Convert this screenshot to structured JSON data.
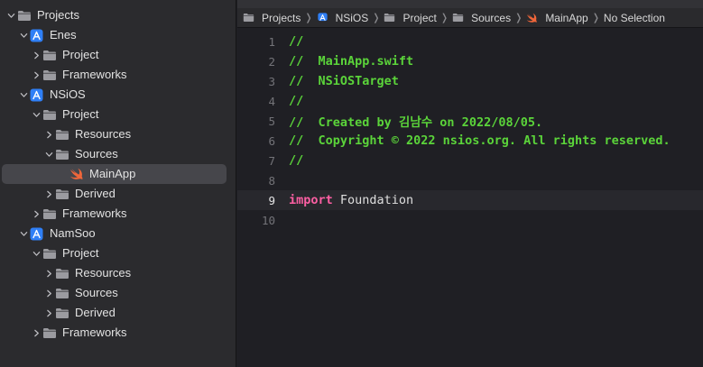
{
  "navigator": {
    "items": [
      {
        "label": "Projects",
        "icon": "folder-icon",
        "depth": 0,
        "expanded": true
      },
      {
        "label": "Enes",
        "icon": "app-target-icon",
        "depth": 1,
        "expanded": true
      },
      {
        "label": "Project",
        "icon": "folder-icon",
        "depth": 2,
        "expanded": false
      },
      {
        "label": "Frameworks",
        "icon": "folder-icon",
        "depth": 2,
        "expanded": false
      },
      {
        "label": "NSiOS",
        "icon": "app-target-icon",
        "depth": 1,
        "expanded": true
      },
      {
        "label": "Project",
        "icon": "folder-icon",
        "depth": 2,
        "expanded": true
      },
      {
        "label": "Resources",
        "icon": "folder-icon",
        "depth": 3,
        "expanded": false
      },
      {
        "label": "Sources",
        "icon": "folder-icon",
        "depth": 3,
        "expanded": true
      },
      {
        "label": "MainApp",
        "icon": "swift-file-icon",
        "depth": 4,
        "selected": true
      },
      {
        "label": "Derived",
        "icon": "folder-icon",
        "depth": 3,
        "expanded": false
      },
      {
        "label": "Frameworks",
        "icon": "folder-icon",
        "depth": 2,
        "expanded": false
      },
      {
        "label": "NamSoo",
        "icon": "app-target-icon",
        "depth": 1,
        "expanded": true
      },
      {
        "label": "Project",
        "icon": "folder-icon",
        "depth": 2,
        "expanded": true
      },
      {
        "label": "Resources",
        "icon": "folder-icon",
        "depth": 3,
        "expanded": false
      },
      {
        "label": "Sources",
        "icon": "folder-icon",
        "depth": 3,
        "expanded": false
      },
      {
        "label": "Derived",
        "icon": "folder-icon",
        "depth": 3,
        "expanded": false
      },
      {
        "label": "Frameworks",
        "icon": "folder-icon",
        "depth": 2,
        "expanded": false
      }
    ]
  },
  "jumpbar": {
    "crumbs": [
      {
        "label": "Projects",
        "icon": "folder-icon"
      },
      {
        "label": "NSiOS",
        "icon": "app-target-icon"
      },
      {
        "label": "Project",
        "icon": "folder-icon"
      },
      {
        "label": "Sources",
        "icon": "folder-icon"
      },
      {
        "label": "MainApp",
        "icon": "swift-file-icon"
      },
      {
        "label": "No Selection",
        "icon": ""
      }
    ]
  },
  "editor": {
    "current_line": 9,
    "lines": [
      {
        "num": "1",
        "segments": [
          {
            "text": "//",
            "kind": "comment"
          }
        ]
      },
      {
        "num": "2",
        "segments": [
          {
            "text": "//  MainApp.swift",
            "kind": "comment"
          }
        ]
      },
      {
        "num": "3",
        "segments": [
          {
            "text": "//  NSiOSTarget",
            "kind": "comment"
          }
        ]
      },
      {
        "num": "4",
        "segments": [
          {
            "text": "//",
            "kind": "comment"
          }
        ]
      },
      {
        "num": "5",
        "segments": [
          {
            "text": "//  Created by 김남수 on 2022/08/05.",
            "kind": "comment"
          }
        ]
      },
      {
        "num": "6",
        "segments": [
          {
            "text": "//  Copyright © 2022 nsios.org. All rights reserved.",
            "kind": "comment"
          }
        ]
      },
      {
        "num": "7",
        "segments": [
          {
            "text": "//",
            "kind": "comment"
          }
        ]
      },
      {
        "num": "8",
        "segments": []
      },
      {
        "num": "9",
        "segments": [
          {
            "text": "import",
            "kind": "kw"
          },
          {
            "text": " Foundation",
            "kind": "plain"
          }
        ]
      },
      {
        "num": "10",
        "segments": []
      }
    ]
  },
  "colors": {
    "comment": "#5bd43a",
    "keyword": "#fc5fa3",
    "app_icon": "#2f7ff6",
    "swift_icon": "#f0663a",
    "folder_icon": "#9b9ba0"
  }
}
